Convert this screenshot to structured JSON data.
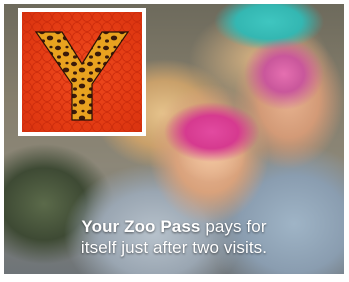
{
  "ad": {
    "caption_bold": "Your Zoo Pass",
    "caption_rest_line1": "pays for",
    "caption_line2": "itself just after two visits."
  },
  "logo": {
    "letter": "Y",
    "icon": "leopard-print-y-logo-icon",
    "background_color": "#e23a12",
    "letter_color": "#e9a21f"
  }
}
